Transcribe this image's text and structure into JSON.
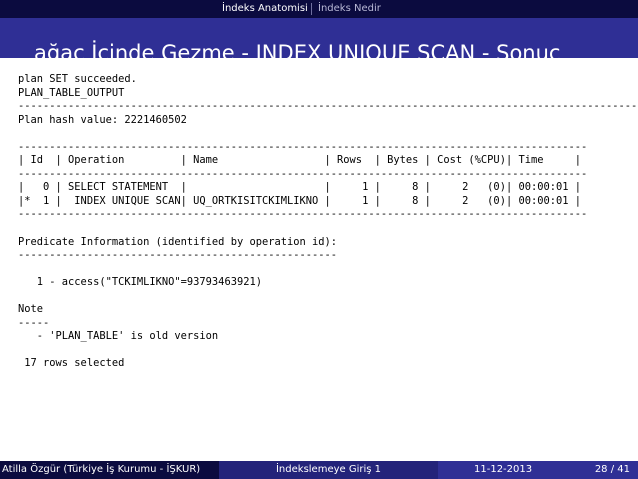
{
  "nav": {
    "items": [
      "İndeks Anatomisi",
      "İndeks Nedir"
    ],
    "active_index": 0
  },
  "slide": {
    "title": "ağaç İçinde Gezme - INDEX UNIQUE SCAN - Sonuç"
  },
  "output": {
    "lines": [
      "plan SET succeeded.",
      "PLAN_TABLE_OUTPUT",
      "----------------------------------------------------------------------------------------------------",
      "Plan hash value: 2221460502",
      "",
      "-------------------------------------------------------------------------------------------",
      "| Id  | Operation         | Name                 | Rows  | Bytes | Cost (%CPU)| Time     |",
      "-------------------------------------------------------------------------------------------",
      "|   0 | SELECT STATEMENT  |                      |     1 |     8 |     2   (0)| 00:00:01 |",
      "|*  1 |  INDEX UNIQUE SCAN| UQ_ORTKISITCKIMLIKNO |     1 |     8 |     2   (0)| 00:00:01 |",
      "-------------------------------------------------------------------------------------------",
      "",
      "Predicate Information (identified by operation id):",
      "---------------------------------------------------",
      "",
      "   1 - access(\"TCKIMLIKNO\"=93793463921)",
      "",
      "Note",
      "-----",
      "   - 'PLAN_TABLE' is old version",
      "",
      " 17 rows selected"
    ]
  },
  "footer": {
    "author": "Atilla Özgür (Türkiye İş Kurumu - İŞKUR)",
    "talk": "İndekslemeye Giriş 1",
    "date": "11-12-2013",
    "page": "28 / 41"
  },
  "colors": {
    "nav_bar": "#0b0b3f",
    "title_bar": "#2f2f95",
    "footer_left": "#0b0b3f",
    "footer_mid": "#23237a",
    "footer_right": "#2f2f95"
  }
}
